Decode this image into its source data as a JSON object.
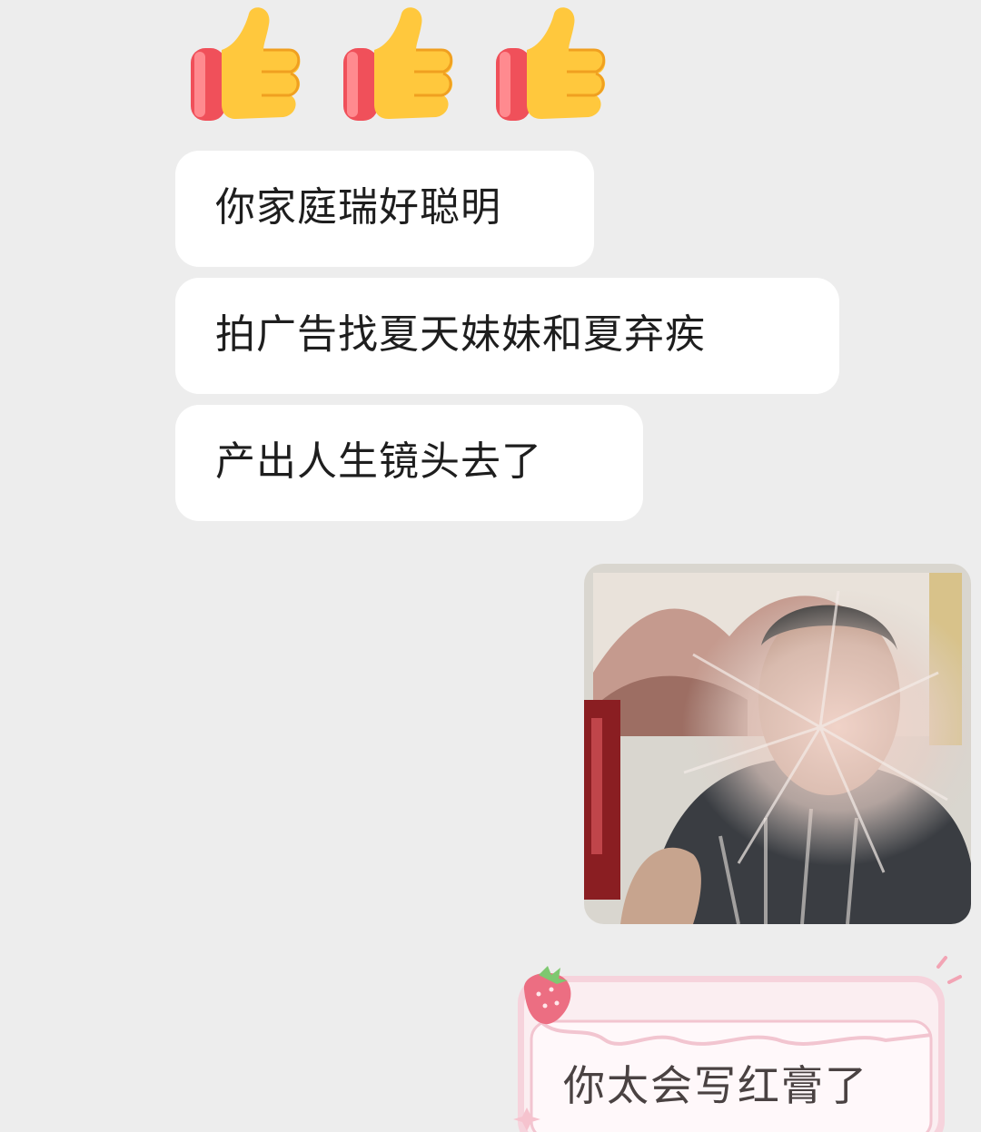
{
  "chat": {
    "emoji_reaction": "thumbs-up x3",
    "messages": [
      {
        "side": "left",
        "type": "text",
        "text": "你家庭瑞好聪明"
      },
      {
        "side": "left",
        "type": "text",
        "text": "拍广告找夏天妹妹和夏弃疾"
      },
      {
        "side": "left",
        "type": "text",
        "text": "产出人生镜头去了"
      },
      {
        "side": "right",
        "type": "image",
        "description": "meme photo"
      },
      {
        "side": "right",
        "type": "sticker-text",
        "text": "你太会写红膏了"
      }
    ]
  },
  "colors": {
    "background": "#ededed",
    "bubble": "#ffffff",
    "sticker_pink": "#f4c9d4",
    "sticker_text": "#4a4242"
  }
}
